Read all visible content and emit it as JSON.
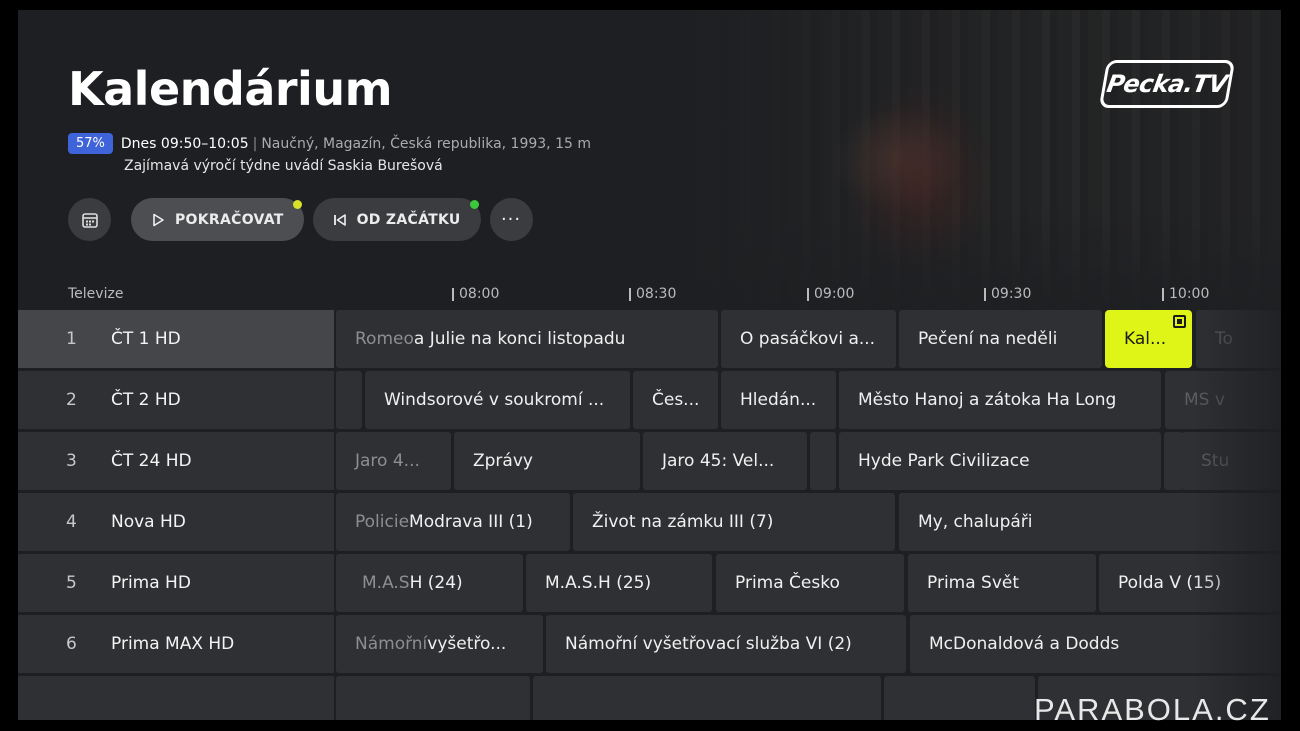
{
  "header": {
    "title": "Kalendárium",
    "progress_percent": 57,
    "progress_label": "57%",
    "time": "Dnes 09:50–10:05",
    "separator": "|",
    "genre": "Naučný, Magazín, Česká republika, 1993, 15 m",
    "description": "Zajímavá výročí týdne uvádí Saskia Burešová"
  },
  "buttons": {
    "calendar_icon": "calendar-icon",
    "continue_label": "POKRAČOVAT",
    "continue_dot_color": "#d8e22a",
    "from_start_label": "OD ZAČÁTKU",
    "from_start_dot_color": "#3cc83c",
    "more_label": "···"
  },
  "logo": {
    "text": "Pecka.TV"
  },
  "timeline": {
    "label": "Televize",
    "ticks": [
      "08:00",
      "08:30",
      "09:00",
      "09:30",
      "10:00"
    ]
  },
  "channels": [
    {
      "num": "1",
      "name": "ČT 1 HD"
    },
    {
      "num": "2",
      "name": "ČT 2 HD"
    },
    {
      "num": "3",
      "name": "ČT 24 HD"
    },
    {
      "num": "4",
      "name": "Nova HD"
    },
    {
      "num": "5",
      "name": "Prima HD"
    },
    {
      "num": "6",
      "name": "Prima MAX HD"
    },
    {
      "num": "",
      "name": ""
    }
  ],
  "programs": {
    "r0": {
      "c0_dim": "Romeo",
      "c0": " a Julie na konci listopadu",
      "c1": "O pasáčkovi a...",
      "c2": "Pečení na neděli",
      "c3": "Kal...",
      "c4": "To"
    },
    "r1": {
      "c0": "Windsorové v soukromí ...",
      "c1": "Čes...",
      "c2": "Hledán...",
      "c3": "Město Hanoj a zátoka Ha Long",
      "c4": "MS v"
    },
    "r2": {
      "c0_dim": "Jaro 4...",
      "c1": "Zprávy",
      "c2": "Jaro 45: Vel...",
      "c3": "Hyde Park Civilizace",
      "c4": "Stu"
    },
    "r3": {
      "c0_dim": "Policie",
      "c0": " Modrava III (1)",
      "c1": "Život na zámku III (7)",
      "c2": "My, chalupáři"
    },
    "r4": {
      "c0_dim": "M.A.S",
      "c0": "H (24)",
      "c1": "M.A.S.H (25)",
      "c2": "Prima Česko",
      "c3": "Prima Svět",
      "c4": "Polda V (15)"
    },
    "r5": {
      "c0_dim": "Námořní",
      "c0": " vyšetřo...",
      "c1": "Námořní vyšetřovací služba VI (2)",
      "c2": "McDonaldová a Dodds"
    }
  },
  "watermark": "PARABOLA.CZ",
  "colors": {
    "accent": "#dff417",
    "badge": "#3f63d8",
    "background": "#1d1f22"
  }
}
